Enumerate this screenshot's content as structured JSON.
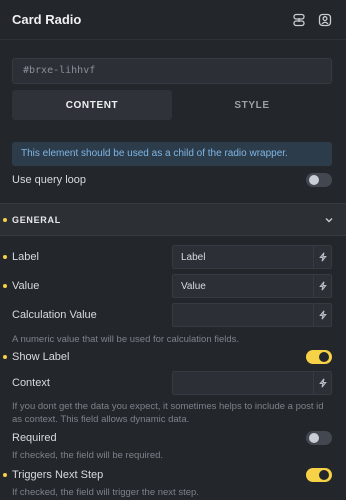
{
  "header": {
    "title": "Card Radio",
    "icons": [
      "link-icon",
      "person-icon"
    ]
  },
  "element_id": "#brxe-lihhvf",
  "tabs": [
    {
      "label": "CONTENT",
      "active": true
    },
    {
      "label": "STYLE",
      "active": false
    }
  ],
  "info_text": "This element should be used as a child of the radio wrapper.",
  "use_query_loop": {
    "label": "Use query loop",
    "on": false
  },
  "section": {
    "title": "GENERAL"
  },
  "fields": {
    "label": {
      "label": "Label",
      "value": "Label"
    },
    "value": {
      "label": "Value",
      "value": "Value"
    },
    "calc": {
      "label": "Calculation Value",
      "value": "",
      "desc": "A numeric value that will be used for calculation fields."
    },
    "context": {
      "label": "Context",
      "value": "",
      "desc": "If you dont get the data you expect, it sometimes helps to include a post id as context. This field allows dynamic data."
    }
  },
  "toggles": {
    "show_label": {
      "label": "Show Label",
      "on": true
    },
    "required": {
      "label": "Required",
      "on": false,
      "desc": "If checked, the field will be required."
    },
    "triggers_next": {
      "label": "Triggers Next Step",
      "on": true,
      "desc": "If checked, the field will trigger the next step."
    }
  },
  "colors": {
    "accent": "#f7d146",
    "info_bg": "#2d3c4a",
    "info_text": "#7fb6e6",
    "bg": "#23262b"
  }
}
